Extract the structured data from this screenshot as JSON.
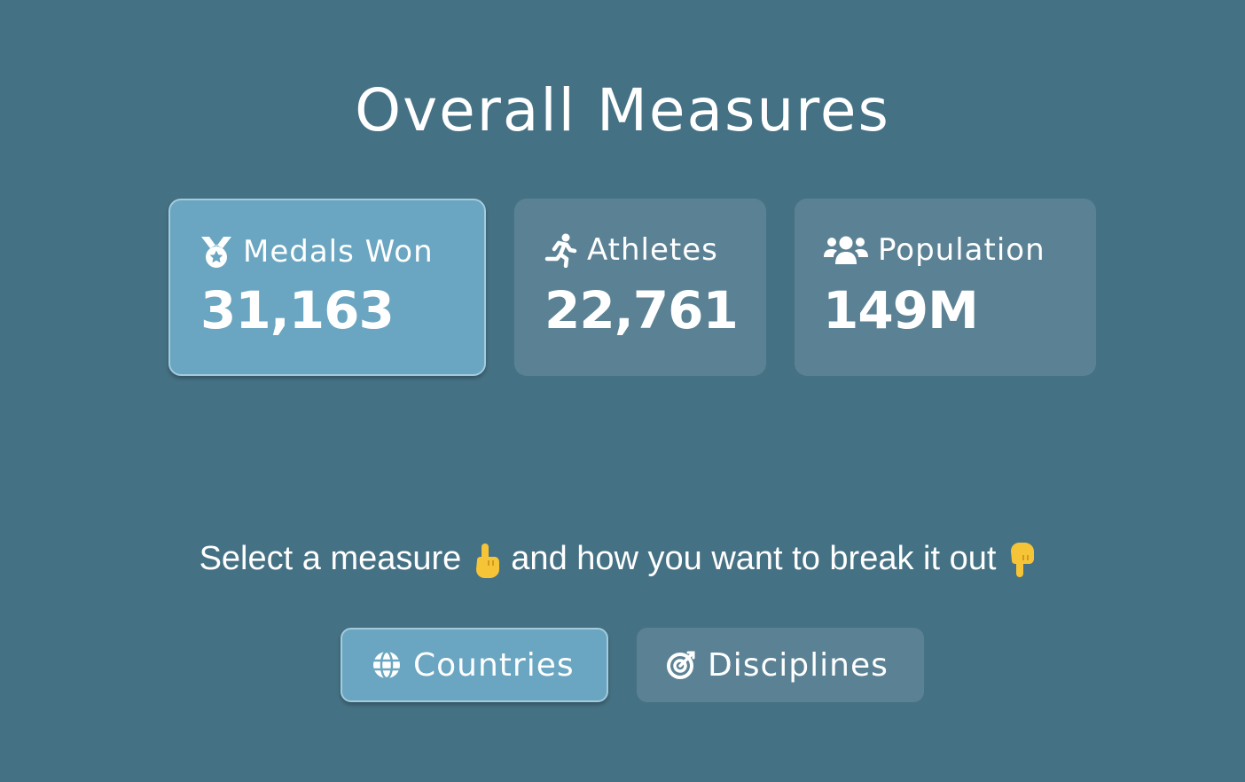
{
  "title": "Overall Measures",
  "measures": [
    {
      "icon": "medal-icon",
      "label": "Medals Won",
      "value": "31,163",
      "selected": true
    },
    {
      "icon": "running-person-icon",
      "label": "Athletes",
      "value": "22,761",
      "selected": false
    },
    {
      "icon": "people-group-icon",
      "label": "Population",
      "value": "149M",
      "selected": false
    }
  ],
  "prompt": {
    "part1": "Select a measure",
    "emoji1": "pointing-up-hand-icon",
    "part2": "and how you want to break it out",
    "emoji2": "pointing-down-hand-icon"
  },
  "breakouts": [
    {
      "icon": "globe-icon",
      "label": "Countries",
      "selected": true
    },
    {
      "icon": "target-icon",
      "label": "Disciplines",
      "selected": false
    }
  ],
  "colors": {
    "background": "#457184",
    "card": "#5b8294",
    "card_selected": "#6aa6c1",
    "emoji": "#f6c437"
  }
}
